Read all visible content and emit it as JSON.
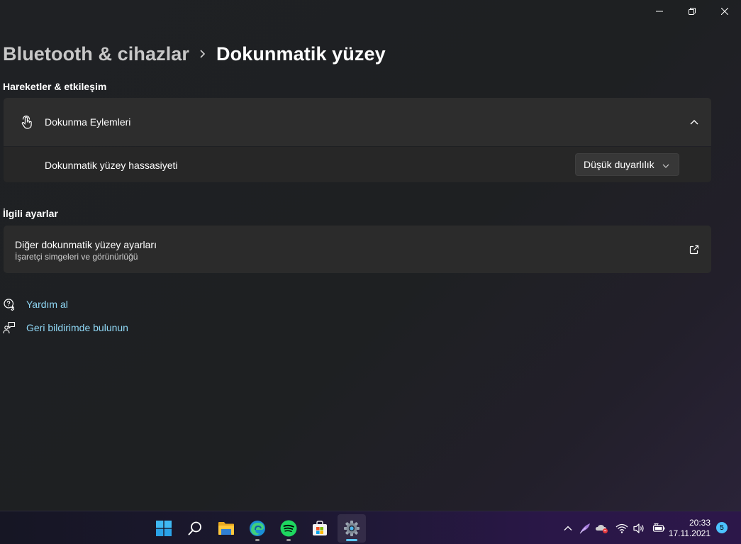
{
  "window": {
    "caption": {
      "minimize": "minimize",
      "maximize": "restore",
      "close": "close"
    }
  },
  "breadcrumb": {
    "parent": "Bluetooth & cihazlar",
    "separator_icon": "chevron-right-icon",
    "current": "Dokunmatik yüzey"
  },
  "sections": {
    "gestures": {
      "title": "Hareketler & etkileşim",
      "tap_card": {
        "label": "Dokunma Eylemleri",
        "icon": "tap-hand-icon",
        "expanded": true,
        "rows": [
          {
            "label": "Dokunmatik yüzey hassasiyeti",
            "value": "Düşük duyarlılık"
          }
        ]
      }
    },
    "related": {
      "title": "İlgili ayarlar",
      "link_card": {
        "title": "Diğer dokunmatik yüzey ayarları",
        "description": "İşaretçi simgeleri ve görünürlüğü",
        "icon": "external-link-icon"
      }
    }
  },
  "help": {
    "get_help": "Yardım al",
    "feedback": "Geri bildirimde bulunun"
  },
  "taskbar": {
    "apps": [
      {
        "name": "start",
        "icon": "windows-logo-icon"
      },
      {
        "name": "search",
        "icon": "search-icon"
      },
      {
        "name": "file-explorer",
        "icon": "folder-icon"
      },
      {
        "name": "edge",
        "icon": "edge-icon",
        "running": true
      },
      {
        "name": "spotify",
        "icon": "spotify-icon",
        "running": true
      },
      {
        "name": "store",
        "icon": "store-icon"
      },
      {
        "name": "settings",
        "icon": "gear-icon",
        "running": true,
        "active": true
      }
    ],
    "clock": {
      "time": "20:33",
      "date": "17.11.2021"
    },
    "notification_count": "5",
    "accent_color": "#5ec8f5"
  }
}
